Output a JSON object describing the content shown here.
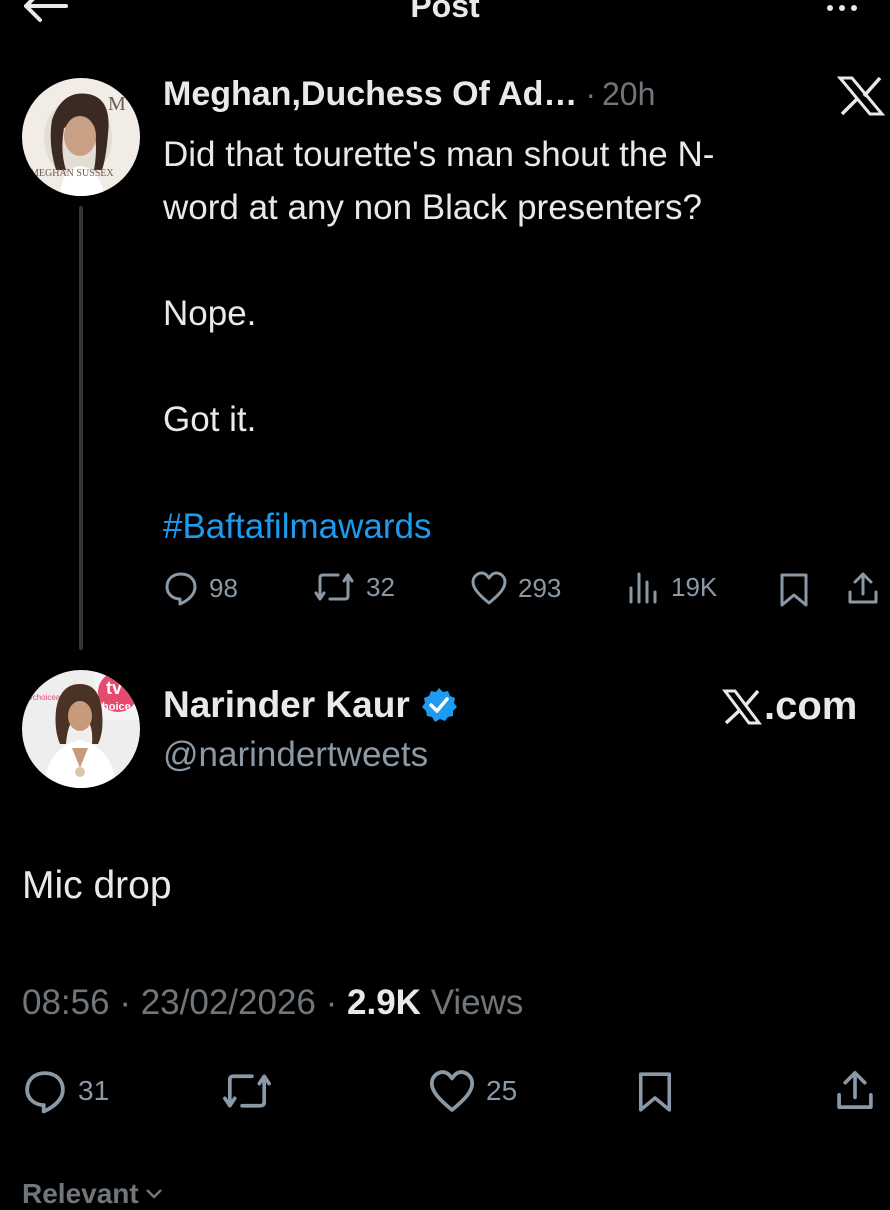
{
  "header": {
    "title": "Post",
    "back_icon": "arrow-left-icon",
    "more_icon": "more-horizontal-icon"
  },
  "colors": {
    "background": "#000000",
    "text": "#e7e9ea",
    "muted": "#71767b",
    "link": "#1d9bf0",
    "verified": "#1d9bf0"
  },
  "post1": {
    "author_name": "Meghan,Duchess Of Ad…",
    "separator": "·",
    "time": "20h",
    "avatar_text": {
      "monogram": "M",
      "caption": "MEGHAN SUSSEX"
    },
    "body": "Did that tourette's man shout the N-\nword at any non Black presenters?\n\nNope.\n\nGot it.",
    "hashtag": "#Baftafilmawards",
    "stats": {
      "replies": "98",
      "reposts": "32",
      "likes": "293",
      "views": "19K"
    }
  },
  "post2": {
    "author_name": "Narinder Kaur",
    "handle": "@narindertweets",
    "verified": true,
    "source": ".com",
    "avatar_text": {
      "badge_top": "tv",
      "badge_bottom": "hoice",
      "side_text": "#tvchoiceawa"
    },
    "body": "Mic drop",
    "time": "08:56",
    "date": "23/02/2026",
    "separator": "·",
    "views_count": "2.9K",
    "views_label": "Views",
    "stats": {
      "replies": "31",
      "likes": "25"
    }
  },
  "footer": {
    "sort_label": "Relevant"
  }
}
